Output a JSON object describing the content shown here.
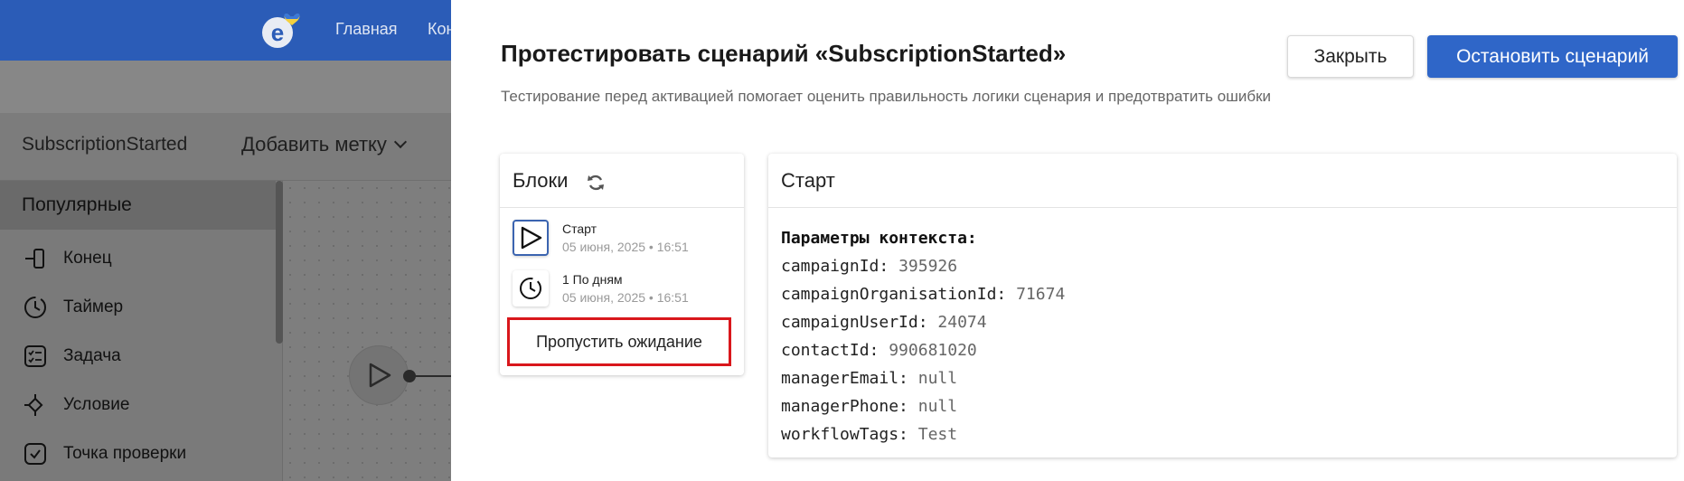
{
  "app": {
    "nav": [
      "Главная",
      "Кон"
    ],
    "scenario_name": "SubscriptionStarted",
    "add_tag_label": "Добавить метку",
    "palette": {
      "section_title": "Популярные",
      "tools": [
        {
          "label": "Конец",
          "icon": "end-icon"
        },
        {
          "label": "Таймер",
          "icon": "timer-icon"
        },
        {
          "label": "Задача",
          "icon": "task-icon"
        },
        {
          "label": "Условие",
          "icon": "condition-icon"
        },
        {
          "label": "Точка проверки",
          "icon": "checkpoint-icon"
        }
      ]
    }
  },
  "drawer": {
    "title": "Протестировать сценарий «SubscriptionStarted»",
    "description": "Тестирование перед активацией помогает оценить правильность логики сценария и предотвратить ошибки",
    "close_label": "Закрыть",
    "stop_label": "Остановить сценарий",
    "blocks": {
      "title": "Блоки",
      "items": [
        {
          "name": "Старт",
          "date": "05 июня, 2025 • 16:51",
          "icon": "play-icon"
        },
        {
          "name": "1 По дням",
          "date": "05 июня, 2025 • 16:51",
          "icon": "clock-icon"
        }
      ],
      "skip_label": "Пропустить ожидание"
    },
    "context": {
      "title": "Старт",
      "heading": "Параметры контекста:",
      "params": [
        {
          "key": "campaignId:",
          "value": "395926"
        },
        {
          "key": "campaignOrganisationId:",
          "value": "71674"
        },
        {
          "key": "campaignUserId:",
          "value": "24074"
        },
        {
          "key": "contactId:",
          "value": "990681020"
        },
        {
          "key": "managerEmail:",
          "value": "null"
        },
        {
          "key": "managerPhone:",
          "value": "null"
        },
        {
          "key": "workflowTags:",
          "value": "Test"
        }
      ]
    }
  },
  "colors": {
    "primary": "#2f66c8",
    "highlight_border": "#d9171c"
  }
}
